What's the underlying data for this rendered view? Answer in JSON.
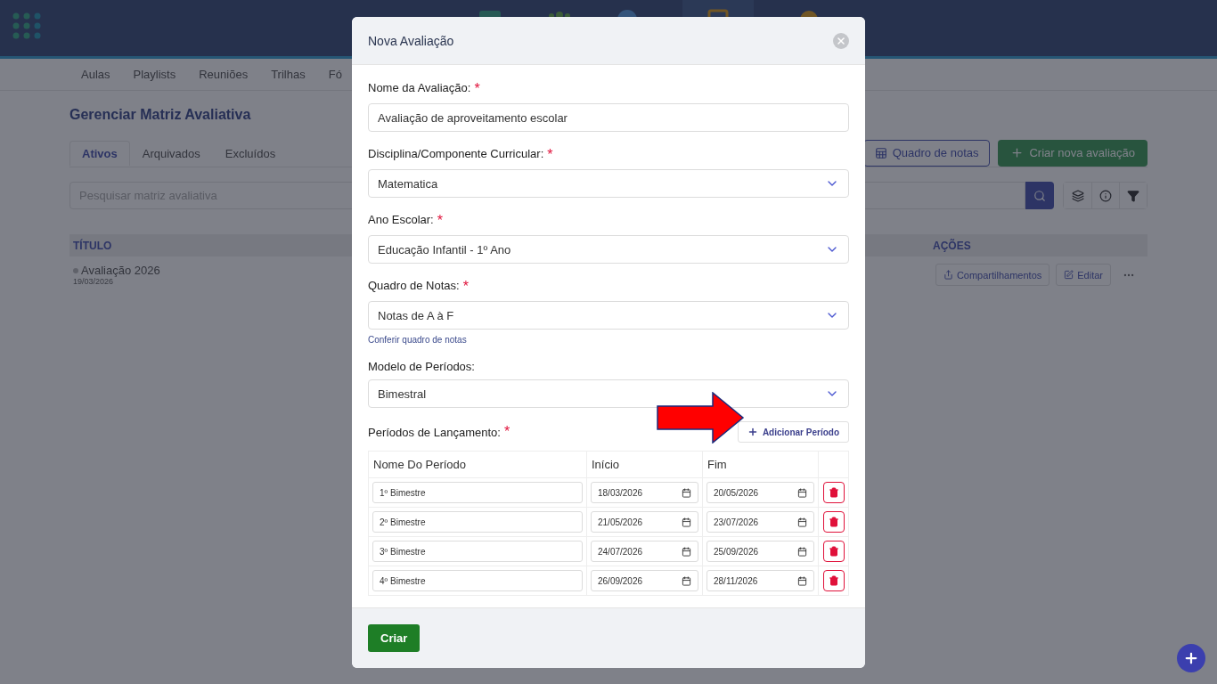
{
  "subnav": [
    {
      "label": "Aulas"
    },
    {
      "label": "Playlists"
    },
    {
      "label": "Reuniões"
    },
    {
      "label": "Trilhas"
    },
    {
      "label": "Fó"
    }
  ],
  "page": {
    "title": "Gerenciar Matriz Avaliativa",
    "tabs": [
      {
        "label": "Ativos",
        "selected": true
      },
      {
        "label": "Arquivados",
        "selected": false
      },
      {
        "label": "Excluídos",
        "selected": false
      }
    ],
    "grades_button": "Quadro de notas",
    "create_button": "Criar nova avaliação",
    "search": {
      "placeholder": "Pesquisar matriz avaliativa"
    },
    "table": {
      "columns": [
        "TÍTULO",
        "AÇÕES"
      ],
      "rows": [
        {
          "title": "Avaliação 2026",
          "date": "19/03/2026",
          "share": "Compartilhamentos",
          "edit": "Editar"
        }
      ]
    }
  },
  "modal": {
    "title": "Nova Avaliação",
    "fields": [
      {
        "kind": "text",
        "label": "Nome da Avaliação:",
        "mark": "*",
        "value": "Avaliação de aproveitamento escolar"
      },
      {
        "kind": "select",
        "label": "Disciplina/Componente Curricular:",
        "mark": "*",
        "value": "Matematica"
      },
      {
        "kind": "select",
        "label": "Ano Escolar:",
        "mark": "*",
        "value": "Educação Infantil - 1º Ano"
      },
      {
        "kind": "select",
        "label": "Quadro de Notas:",
        "mark": "*",
        "value": "Notas de A à F",
        "link": "Conferir quadro de notas"
      },
      {
        "kind": "select",
        "label": "Modelo de Períodos:",
        "value": "Bimestral"
      }
    ],
    "periods": {
      "label": "Períodos de Lançamento:",
      "mark": "*",
      "add_button": "Adicionar Período",
      "columns": [
        "Nome Do Período",
        "Início",
        "Fim"
      ],
      "rows": [
        {
          "name": "1º Bimestre",
          "start": "18/03/2026",
          "end": "20/05/2026"
        },
        {
          "name": "2º Bimestre",
          "start": "21/05/2026",
          "end": "23/07/2026"
        },
        {
          "name": "3º Bimestre",
          "start": "24/07/2026",
          "end": "25/09/2026"
        },
        {
          "name": "4º Bimestre",
          "start": "26/09/2026",
          "end": "28/11/2026"
        }
      ]
    },
    "submit": "Criar"
  }
}
